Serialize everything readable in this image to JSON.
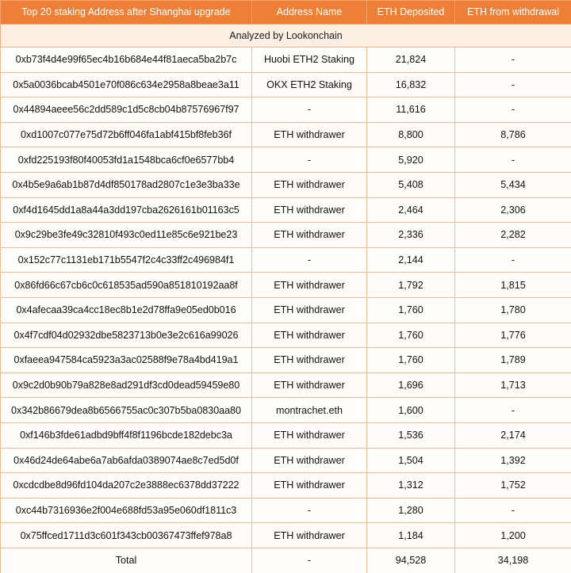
{
  "table": {
    "columns": [
      "Top 20 staking Address after Shanghai upgrade",
      "Address Name",
      "ETH Deposited",
      "ETH from withdrawal"
    ],
    "subtitle": "Analyzed by Lookonchain",
    "accent_color": "#ed8036",
    "header_text_color": "#ffffff",
    "subtitle_bg_color": "#fdeee2",
    "border_color": "#f4bb92",
    "rows": [
      {
        "address": "0xb73f4d4e99f65ec4b16b684e44f81aeca5ba2b7c",
        "name": "Huobi ETH2 Staking",
        "deposited": "21,824",
        "withdrawal": "-"
      },
      {
        "address": "0x5a0036bcab4501e70f086c634e2958a8beae3a11",
        "name": "OKX ETH2 Staking",
        "deposited": "16,832",
        "withdrawal": "-"
      },
      {
        "address": "0x44894aeee56c2dd589c1d5c8cb04b87576967f97",
        "name": "-",
        "deposited": "11,616",
        "withdrawal": "-"
      },
      {
        "address": "0xd1007c077e75d72b6ff046fa1abf415bf8feb36f",
        "name": "ETH withdrawer",
        "deposited": "8,800",
        "withdrawal": "8,786"
      },
      {
        "address": "0xfd225193f80f40053fd1a1548bca6cf0e6577bb4",
        "name": "-",
        "deposited": "5,920",
        "withdrawal": "-"
      },
      {
        "address": "0x4b5e9a6ab1b87d4df850178ad2807c1e3e3ba33e",
        "name": "ETH withdrawer",
        "deposited": "5,408",
        "withdrawal": "5,434"
      },
      {
        "address": "0xf4d1645dd1a8a44a3dd197cba2626161b01163c5",
        "name": "ETH withdrawer",
        "deposited": "2,464",
        "withdrawal": "2,306"
      },
      {
        "address": "0x9c29be3fe49c32810f493c0ed11e85c6e921be23",
        "name": "ETH withdrawer",
        "deposited": "2,336",
        "withdrawal": "2,282"
      },
      {
        "address": "0x152c77c1131eb171b5547f2c4c33ff2c496984f1",
        "name": "-",
        "deposited": "2,144",
        "withdrawal": "-"
      },
      {
        "address": "0x86fd66c67cb6c0c618535ad590a851810192aa8f",
        "name": "ETH withdrawer",
        "deposited": "1,792",
        "withdrawal": "1,815"
      },
      {
        "address": "0x4afecaa39ca4cc18ec8b1e2d78ffa9e05ed0b016",
        "name": "ETH withdrawer",
        "deposited": "1,760",
        "withdrawal": "1,780"
      },
      {
        "address": "0x4f7cdf04d02932dbe5823713b0e3e2c616a99026",
        "name": "ETH withdrawer",
        "deposited": "1,760",
        "withdrawal": "1,776"
      },
      {
        "address": "0xfaeea947584ca5923a3ac02588f9e78a4bd419a1",
        "name": "ETH withdrawer",
        "deposited": "1,760",
        "withdrawal": "1,789"
      },
      {
        "address": "0x9c2d0b90b79a828e8ad291df3cd0dead59459e80",
        "name": "ETH withdrawer",
        "deposited": "1,696",
        "withdrawal": "1,713"
      },
      {
        "address": "0x342b86679dea8b6566755ac0c307b5ba0830aa80",
        "name": "montrachet.eth",
        "deposited": "1,600",
        "withdrawal": "-"
      },
      {
        "address": "0xf146b3fde61adbd9bff4f8f1196bcde182debc3a",
        "name": "ETH withdrawer",
        "deposited": "1,536",
        "withdrawal": "2,174"
      },
      {
        "address": "0x46d24de64abe6a7ab6afda0389074ae8c7ed5d0f",
        "name": "ETH withdrawer",
        "deposited": "1,504",
        "withdrawal": "1,392"
      },
      {
        "address": "0xcdcdbe8d96fd104da207c2e3888ec6378dd37222",
        "name": "ETH withdrawer",
        "deposited": "1,312",
        "withdrawal": "1,752"
      },
      {
        "address": "0xc44b7316936e2f004e688fd53a95e060df1811c3",
        "name": "-",
        "deposited": "1,280",
        "withdrawal": "-"
      },
      {
        "address": "0x75ffced1711d3c601f343cb00367473ffef978a8",
        "name": "ETH withdrawer",
        "deposited": "1,184",
        "withdrawal": "1,200"
      }
    ],
    "total": {
      "address": "Total",
      "name": "-",
      "deposited": "94,528",
      "withdrawal": "34,198"
    }
  }
}
